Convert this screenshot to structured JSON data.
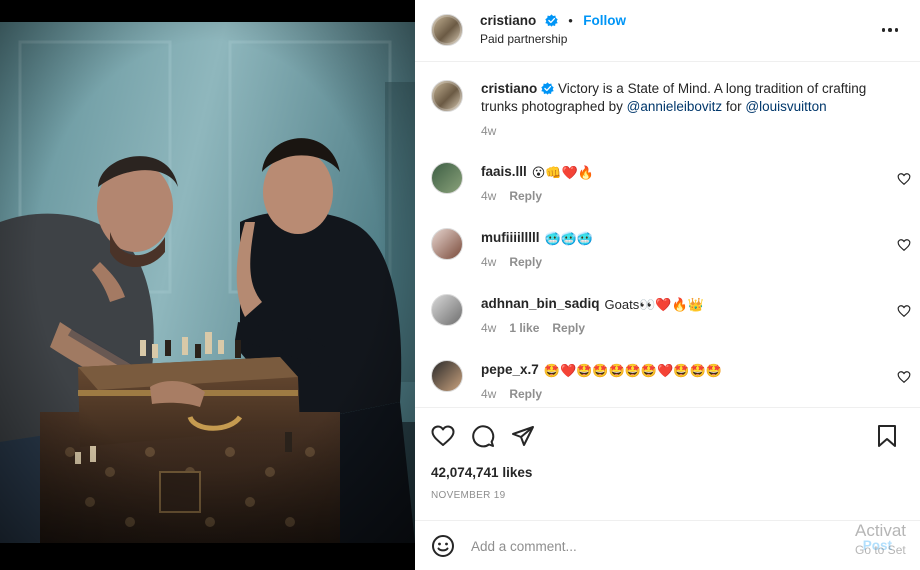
{
  "post": {
    "author": "cristiano",
    "follow_label": "Follow",
    "subtitle": "Paid partnership",
    "caption": {
      "username": "cristiano",
      "text_before": "Victory is a State of Mind. A long tradition of crafting trunks photographed by ",
      "mention1": "@annieleibovitz",
      "text_between": " for ",
      "mention2": "@louisvuitton",
      "time": "4w"
    }
  },
  "comments": [
    {
      "username": "faais.lll",
      "text": "😮👊❤️🔥",
      "time": "4w",
      "likes": "",
      "reply_label": "Reply"
    },
    {
      "username": "mufiiiilllll",
      "text": "🥶🥶🥶",
      "time": "4w",
      "likes": "",
      "reply_label": "Reply"
    },
    {
      "username": "adhnan_bin_sadiq",
      "text": "Goats👀❤️🔥👑",
      "time": "4w",
      "likes": "1 like",
      "reply_label": "Reply"
    },
    {
      "username": "pepe_x.7",
      "text": "🤩❤️🤩🤩🤩🤩🤩❤️🤩🤩🤩",
      "time": "4w",
      "likes": "",
      "reply_label": "Reply"
    }
  ],
  "stats": {
    "likes": "42,074,741 likes",
    "date": "NOVEMBER 19"
  },
  "add_comment": {
    "placeholder": "Add a comment...",
    "post_label": "Post"
  },
  "watermark": {
    "line1": "Activat",
    "line2": "Go to Set"
  },
  "colors": {
    "accent": "#0095f6",
    "mention": "#00376b",
    "muted": "#8e8e8e"
  }
}
